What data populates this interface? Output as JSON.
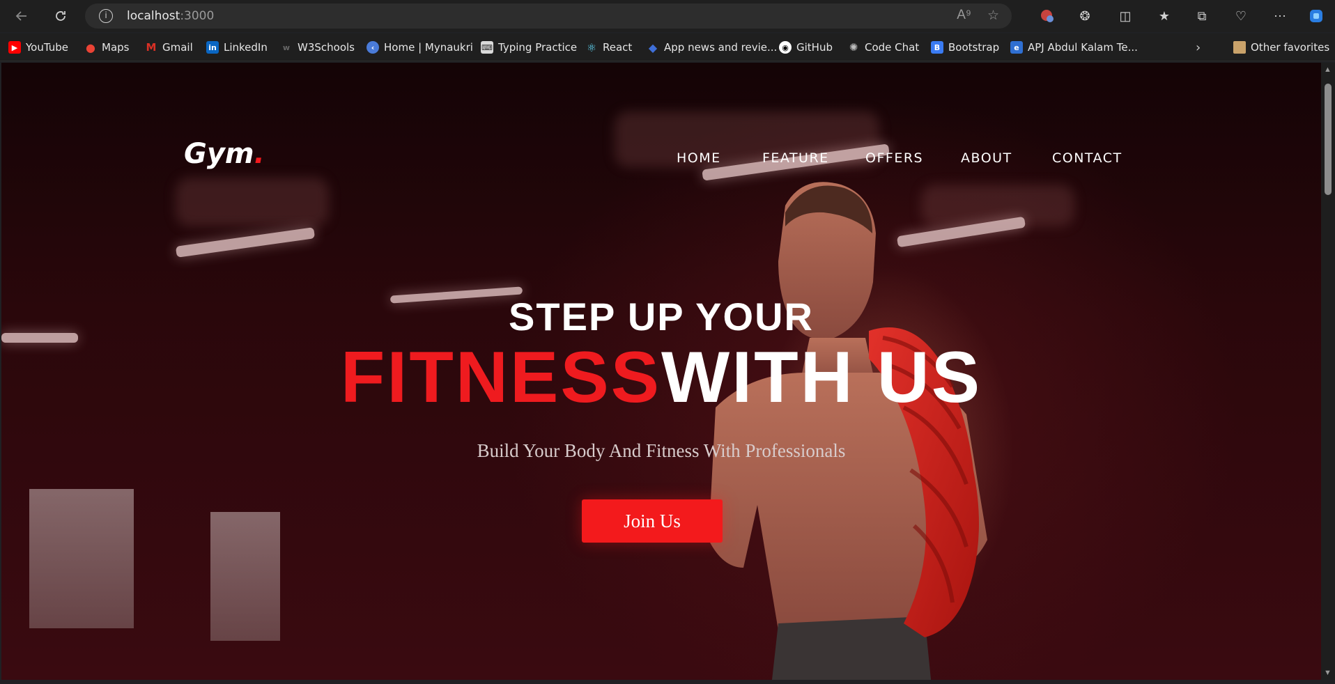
{
  "browser": {
    "url_host": "localhost",
    "url_port": ":3000",
    "bookmarks": [
      {
        "label": "YouTube",
        "icon": "youtube-icon",
        "color": "#ff0000"
      },
      {
        "label": "Maps",
        "icon": "maps-icon",
        "color": "#ea4335"
      },
      {
        "label": "Gmail",
        "icon": "gmail-icon",
        "color": "#d93025"
      },
      {
        "label": "LinkedIn",
        "icon": "linkedin-icon",
        "color": "#0a66c2"
      },
      {
        "label": "W3Schools",
        "icon": "w3schools-icon",
        "color": "#555555"
      },
      {
        "label": "Home | Mynaukri",
        "icon": "mynaukri-icon",
        "color": "#4a7bd8"
      },
      {
        "label": "Typing Practice",
        "icon": "typing-icon",
        "color": "#cfcfcf"
      },
      {
        "label": "React",
        "icon": "react-icon",
        "color": "#61dafb"
      },
      {
        "label": "App news and revie...",
        "icon": "app-news-icon",
        "color": "#3f6fd8"
      },
      {
        "label": "GitHub",
        "icon": "github-icon",
        "color": "#ffffff"
      },
      {
        "label": "Code Chat",
        "icon": "code-chat-icon",
        "color": "#bdbdbd"
      },
      {
        "label": "Bootstrap",
        "icon": "bootstrap-icon",
        "color": "#3a7bf2"
      },
      {
        "label": "APJ Abdul Kalam Te...",
        "icon": "apj-icon",
        "color": "#2f6fd1"
      }
    ],
    "other_favorites": "Other favorites"
  },
  "site": {
    "logo": "Gym",
    "logo_dot": ".",
    "nav": [
      "HOME",
      "FEATURE",
      "OFFERS",
      "ABOUT",
      "CONTACT"
    ],
    "hero_line1": "STEP UP YOUR",
    "hero_red": "FITNESS",
    "hero_white": "WITH US",
    "subtitle": "Build Your Body And Fitness With Professionals",
    "cta": "Join Us",
    "accent_color": "#ef1b1f"
  }
}
